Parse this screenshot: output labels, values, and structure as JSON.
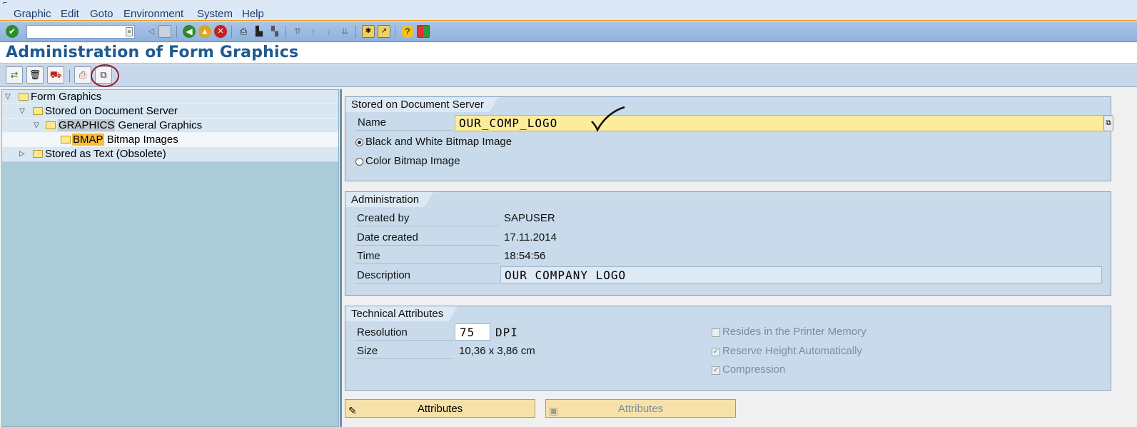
{
  "menu": {
    "items": [
      "Graphic",
      "Edit",
      "Goto",
      "Environment",
      "System",
      "Help"
    ]
  },
  "title": "Administration of Form Graphics",
  "tree": {
    "root": "Form Graphics",
    "doc_server": "Stored on Document Server",
    "graphics_key": "GRAPHICS",
    "graphics_label": "General Graphics",
    "bmap_key": "BMAP",
    "bmap_label": "Bitmap Images",
    "text_node": "Stored as Text (Obsolete)"
  },
  "doc_server_group": {
    "title": "Stored on Document Server",
    "name_label": "Name",
    "name_value": "OUR_COMP_LOGO",
    "radio_bw": "Black and White Bitmap Image",
    "radio_color": "Color Bitmap Image",
    "selected": "bw"
  },
  "admin_group": {
    "title": "Administration",
    "created_by_label": "Created by",
    "created_by": "SAPUSER",
    "date_label": "Date created",
    "date": "17.11.2014",
    "time_label": "Time",
    "time": "18:54:56",
    "desc_label": "Description",
    "desc": "OUR COMPANY LOGO"
  },
  "tech_group": {
    "title": "Technical Attributes",
    "res_label": "Resolution",
    "res_value": "75",
    "res_unit": "DPI",
    "size_label": "Size",
    "size_value": "10,36 x 3,86 cm",
    "chk_printer": "Resides in the Printer Memory",
    "chk_height": "Reserve Height Automatically",
    "chk_compression": "Compression"
  },
  "buttons": {
    "attributes_edit": "Attributes",
    "attributes_display": "Attributes"
  }
}
